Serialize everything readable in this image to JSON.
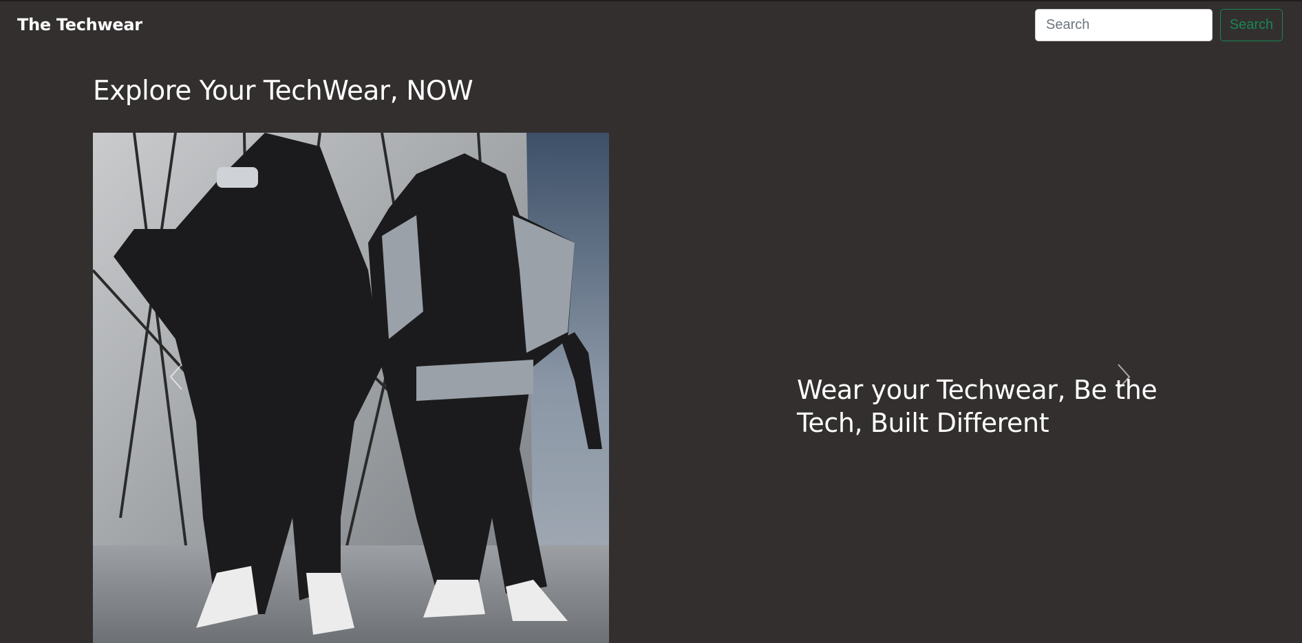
{
  "navbar": {
    "brand": "The Techwear",
    "search": {
      "placeholder": "Search",
      "value": "",
      "button_label": "Search"
    }
  },
  "main": {
    "title": "Explore Your TechWear, NOW",
    "carousel": {
      "slides": [
        {
          "caption": "Wear your Techwear, Be the Tech, Built Different"
        }
      ],
      "icons": {
        "prev": "chevron-left-icon",
        "next": "chevron-right-icon"
      }
    }
  },
  "colors": {
    "background": "#332f2f",
    "accent_success": "#198754",
    "text": "#ffffff"
  }
}
